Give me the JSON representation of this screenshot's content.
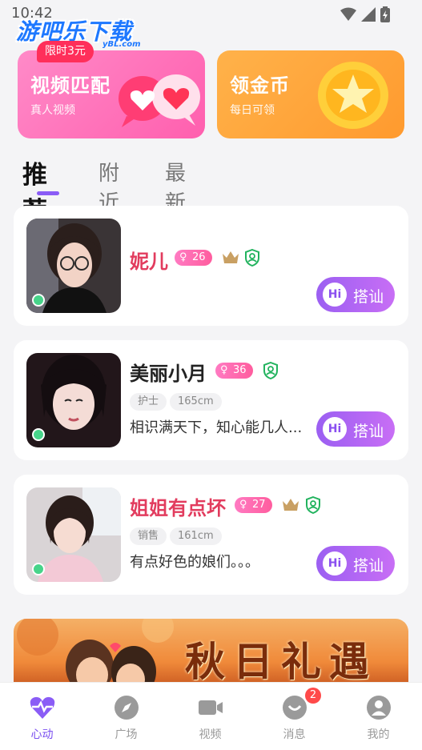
{
  "status_bar": {
    "time": "10:42"
  },
  "watermark": {
    "text": "游吧乐下载",
    "sub": "yBL.com"
  },
  "banners": [
    {
      "title": "视频匹配",
      "subtitle": "真人视频",
      "badge": "限时3元"
    },
    {
      "title": "领金币",
      "subtitle": "每日可领"
    }
  ],
  "tabs": [
    "推荐",
    "附近",
    "最新"
  ],
  "users": [
    {
      "name": "妮儿",
      "age": "26",
      "gender_symbol": "♀",
      "vip": true,
      "verified": true,
      "tags": [],
      "bio": "",
      "action": "搭讪",
      "hi": "Hi",
      "online": true
    },
    {
      "name": "美丽小月",
      "age": "36",
      "gender_symbol": "♀",
      "vip": false,
      "verified": true,
      "tags": [
        "护士",
        "165cm"
      ],
      "bio": "相识满天下，知心能几人...",
      "action": "搭讪",
      "hi": "Hi",
      "online": true
    },
    {
      "name": "姐姐有点坏",
      "age": "27",
      "gender_symbol": "♀",
      "vip": true,
      "verified": true,
      "tags": [
        "销售",
        "161cm"
      ],
      "bio": "有点好色的娘们。。。",
      "action": "搭讪",
      "hi": "Hi",
      "online": true
    }
  ],
  "promo_banner": {
    "title": "秋日礼遇"
  },
  "nav": [
    {
      "label": "心动",
      "icon": "heart-pulse-icon",
      "active": true
    },
    {
      "label": "广场",
      "icon": "compass-icon"
    },
    {
      "label": "视频",
      "icon": "video-camera-icon"
    },
    {
      "label": "消息",
      "icon": "message-icon",
      "badge": "2"
    },
    {
      "label": "我的",
      "icon": "profile-icon"
    }
  ],
  "colors": {
    "accent": "#8a5cf6",
    "pink": "#ff5fae",
    "orange": "#ff9a2e",
    "name_red": "#e23c5e",
    "online": "#47d48a"
  }
}
